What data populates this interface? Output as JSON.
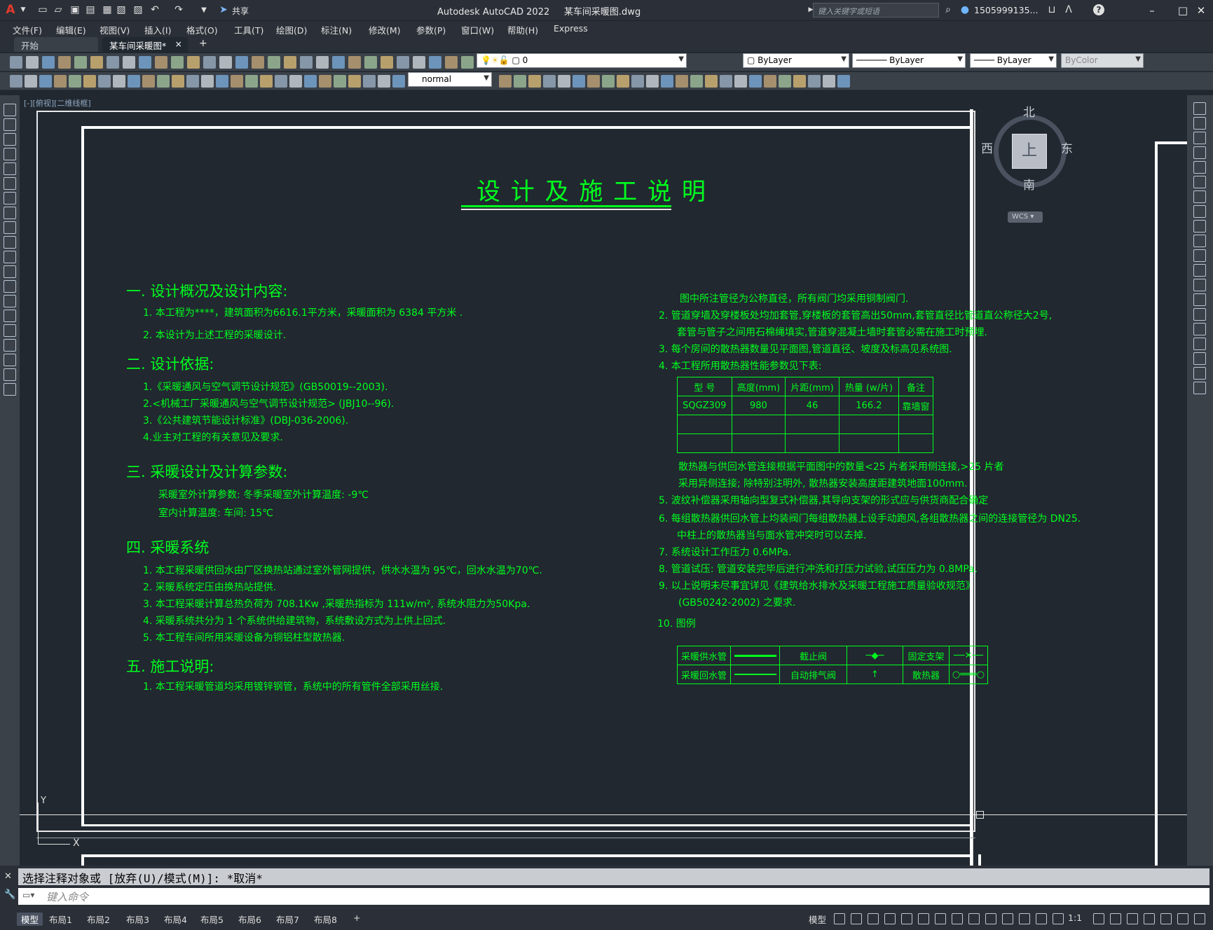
{
  "app": {
    "title": "Autodesk AutoCAD 2022",
    "filename": "某车间采暖图.dwg",
    "share_label": "共享",
    "search_placeholder": "键入关键字或短语",
    "user": "1505999135...",
    "logo": "A"
  },
  "menu": [
    "文件(F)",
    "编辑(E)",
    "视图(V)",
    "插入(I)",
    "格式(O)",
    "工具(T)",
    "绘图(D)",
    "标注(N)",
    "修改(M)",
    "参数(P)",
    "窗口(W)",
    "帮助(H)",
    "Express"
  ],
  "tabs": {
    "start": "开始",
    "active": "某车间采暖图*",
    "add": "+",
    "close": "×"
  },
  "toolbar": {
    "layer_value": "0",
    "color_value": "ByLayer",
    "linetype_value": "ByLayer",
    "lineweight_value": "ByLayer",
    "plotstyle_value": "ByColor",
    "dimstyle_value": "normal"
  },
  "viewport": {
    "label": "[-][俯视][二维线框]"
  },
  "viewcube": {
    "north": "北",
    "south": "南",
    "east": "东",
    "west": "西",
    "top": "上",
    "wcs": "WCS"
  },
  "axes": {
    "x": "X",
    "y": "Y"
  },
  "sheet": {
    "title": "设 计 及 施 工 说 明",
    "s1": {
      "heading": "一. 设计概况及设计内容:",
      "items": [
        "1. 本工程为****，建筑面积为6616.1平方米，采暖面积为 6384 平方米 .",
        "2. 本设计为上述工程的采暖设计."
      ]
    },
    "s2": {
      "heading": "二. 设计依据:",
      "items": [
        "1.《采暖通风与空气调节设计规范》(GB50019--2003).",
        "2.<机械工厂采暖通风与空气调节设计规范> (JBJ10--96).",
        "3.《公共建筑节能设计标准》(DBJ-036-2006).",
        "4.业主对工程的有关意见及要求."
      ]
    },
    "s3": {
      "heading": "三. 采暖设计及计算参数:",
      "items": [
        "采暖室外计算参数:   冬季采暖室外计算温度: -9℃",
        "室内计算温度: 车间: 15℃"
      ]
    },
    "s4": {
      "heading": "四. 采暖系统",
      "items": [
        "1. 本工程采暖供回水由厂区换热站通过室外管网提供，供水水温为 95℃，回水水温为70℃.",
        "2. 采暖系统定压由换热站提供.",
        "3. 本工程采暖计算总热负荷为 708.1Kw ,采暖热指标为 111w/m², 系统水阻力为50Kpa.",
        "4. 采暖系统共分为 1 个系统供给建筑物，系统敷设方式为上供上回式.",
        "5. 本工程车间所用采暖设备为铜铝柱型散热器."
      ]
    },
    "s5": {
      "heading": "五. 施工说明:",
      "items": [
        "1. 本工程采暖管道均采用镀锌钢管，系统中的所有管件全部采用丝接."
      ]
    },
    "right": {
      "r0": "图中所注管径为公称直径，所有阀门均采用铜制阀门.",
      "r2a": "2.  管道穿墙及穿楼板处均加套管,穿楼板的套管高出50mm,套管直径比管道直公称径大2号,",
      "r2b": "套管与管子之间用石棉绳填实,管道穿混凝土墙时套管必需在施工时预埋.",
      "r3": "3.  每个房间的散热器数量见平面图,管道直径、坡度及标高见系统图.",
      "r4": "4.  本工程所用散热器性能参数见下表:",
      "table_header": [
        "型  号",
        "高度(mm)",
        "片距(mm)",
        "热量 (w/片)",
        "备注"
      ],
      "table_row": [
        "SQGZ309",
        "980",
        "46",
        "166.2",
        "靠墙窗"
      ],
      "r4a": "散热器与供回水管连接根据平面图中的数量<25 片者采用侧连接,>25 片者",
      "r4b": "采用异侧连接; 除特别注明外, 散热器安装高度距建筑地面100mm.",
      "r5": "5.  波纹补偿器采用轴向型复式补偿器,其导向支架的形式应与供货商配合确定",
      "r6a": "6.  每组散热器供回水管上均装阀门每组散热器上设手动跑风,各组散热器之间的连接管径为 DN25.",
      "r6b": "中柱上的散热器当与面水管冲突时可以去掉.",
      "r7": "7.  系统设计工作压力 0.6MPa.",
      "r8": "8.  管道试压: 管道安装完毕后进行冲洗和打压力试验,试压压力为 0.8MPa.",
      "r9a": "9.  以上说明未尽事宜详见《建筑给水排水及采暖工程施工质量验收规范》",
      "r9b": "(GB50242-2002) 之要求.",
      "r10": "10. 图例",
      "legend": [
        "采暖供水管",
        "截止阀",
        "固定支架",
        "采暖回水管",
        "自动排气阀",
        "散热器"
      ]
    }
  },
  "command": {
    "history": "选择注释对象或 [放弃(U)/模式(M)]: *取消*",
    "placeholder": "键入命令"
  },
  "layouts": [
    "模型",
    "布局1",
    "布局2",
    "布局3",
    "布局4",
    "布局5",
    "布局6",
    "布局7",
    "布局8"
  ],
  "status": {
    "model": "模型",
    "scale": "1:1"
  },
  "colors": {
    "green": "#00ff1e",
    "yellow": "#e9ee2c",
    "bg": "#212830"
  }
}
